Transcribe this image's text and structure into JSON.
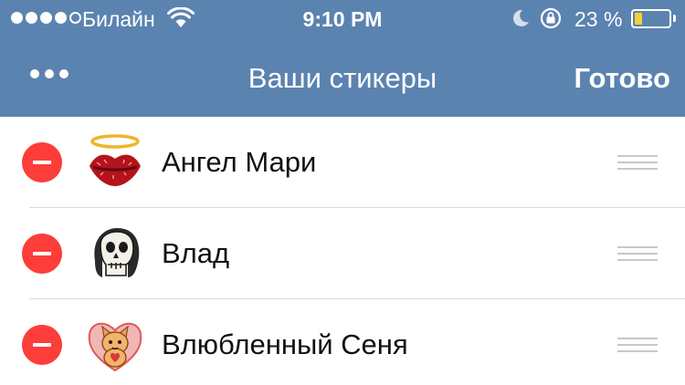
{
  "status_bar": {
    "carrier": "Билайн",
    "time": "9:10 PM",
    "battery_percent": "23 %",
    "battery_level": 0.23,
    "signal_strength": 4,
    "signal_max": 5
  },
  "nav": {
    "title": "Ваши стикеры",
    "done_label": "Готово",
    "more_icon": "ellipsis-icon"
  },
  "stickers": [
    {
      "name": "Ангел Мари",
      "icon": "angel-lips-sticker-icon"
    },
    {
      "name": "Влад",
      "icon": "skull-vlad-sticker-icon"
    },
    {
      "name": "Влюбленный Сеня",
      "icon": "heart-cat-sticker-icon"
    }
  ],
  "colors": {
    "nav_background": "#5b83b0",
    "delete_button": "#fc3d39",
    "battery_fill": "#f5d03b"
  }
}
